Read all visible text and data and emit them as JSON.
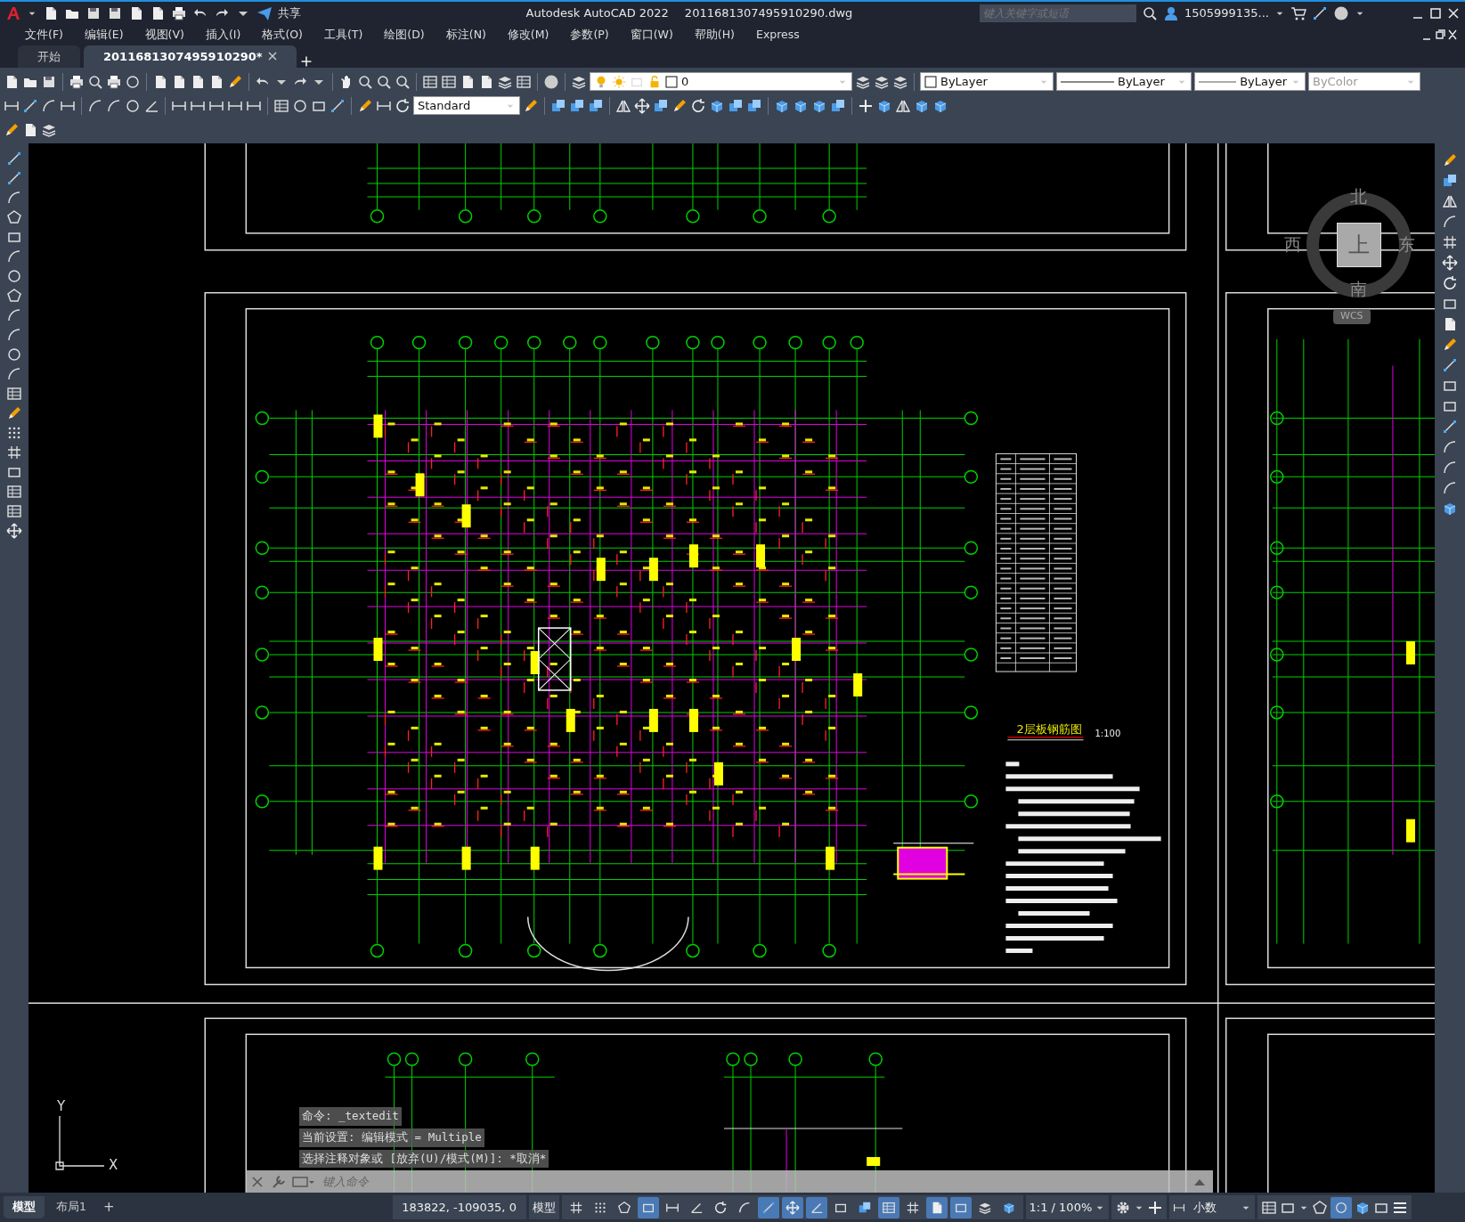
{
  "title_bar": {
    "share_label": "共享",
    "app_title": "Autodesk AutoCAD 2022",
    "file_name": "2011681307495910290.dwg",
    "search": {
      "placeholder": "键入关键字或短语"
    },
    "user": "1505999135..."
  },
  "menu": [
    "文件(F)",
    "编辑(E)",
    "视图(V)",
    "插入(I)",
    "格式(O)",
    "工具(T)",
    "绘图(D)",
    "标注(N)",
    "修改(M)",
    "参数(P)",
    "窗口(W)",
    "帮助(H)",
    "Express"
  ],
  "doc_tabs": [
    {
      "label": "开始",
      "selected": false
    },
    {
      "label": "2011681307495910290*",
      "selected": true
    }
  ],
  "properties_toolbar": {
    "layer": "0",
    "text_style": "Standard",
    "color_setting": "ByLayer",
    "linetype": "ByLayer",
    "lineweight": "ByLayer",
    "plot_style": {
      "value": "ByColor",
      "disabled": true
    }
  },
  "drawing": {
    "title": "2层板钢筋图",
    "scale": "1:100"
  },
  "viewcube": {
    "north": "北",
    "south": "南",
    "east": "东",
    "west": "西",
    "face": "上",
    "ucs_menu": "WCS"
  },
  "ucs_icon": {
    "y_label": "Y",
    "x_label": "X"
  },
  "command_line": {
    "history": [
      "命令: _textedit",
      "当前设置: 编辑模式 = Multiple",
      "选择注释对象或 [放弃(U)/模式(M)]: *取消*"
    ],
    "placeholder": "键入命令"
  },
  "layout_tabs": [
    {
      "label": "模型",
      "selected": true
    },
    {
      "label": "布局1",
      "selected": false
    }
  ],
  "add_layout": "+",
  "status_bar": {
    "coordinates": "183822, -109035, 0",
    "space": "模型",
    "annotation_scale": "1:1 / 100%",
    "units": "小数",
    "toggles": [
      {
        "on": false
      },
      {
        "on": false
      },
      {
        "on": false
      },
      {
        "on": true
      },
      {
        "on": false
      },
      {
        "on": false
      },
      {
        "on": false
      },
      {
        "on": false
      },
      {
        "on": true
      },
      {
        "on": true
      },
      {
        "on": true
      },
      {
        "on": false
      },
      {
        "on": false
      },
      {
        "on": true
      },
      {
        "on": false
      },
      {
        "on": true
      },
      {
        "on": true
      },
      {
        "on": false
      },
      {
        "on": false
      }
    ],
    "isolate_on": true
  }
}
